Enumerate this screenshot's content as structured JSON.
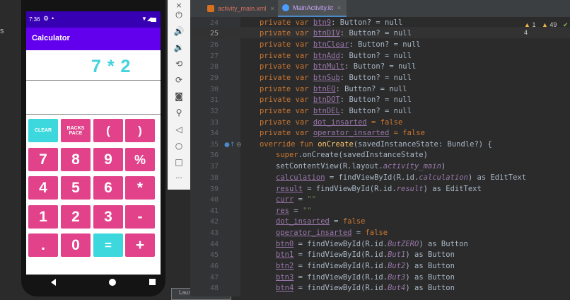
{
  "sidebar": {
    "fragment": "s"
  },
  "phone": {
    "status": {
      "time": "7:36",
      "gear": "⚙",
      "dot": "•",
      "wifi": "▼◢"
    },
    "app_title": "Calculator",
    "calculation": "7 * 2",
    "result": "",
    "buttons": {
      "clear": "CLEAR",
      "backspace": "BACKS PACE",
      "lparen": "(",
      "rparen": ")",
      "b7": "7",
      "b8": "8",
      "b9": "9",
      "percent": "%",
      "b4": "4",
      "b5": "5",
      "b6": "6",
      "mult": "*",
      "b1": "1",
      "b2": "2",
      "b3": "3",
      "minus": "-",
      "dot": ".",
      "b0": "0",
      "eq": "=",
      "plus": "+"
    },
    "nav": {
      "back": "back-icon",
      "home": "home-icon",
      "recents": "recents-icon"
    }
  },
  "toolbar": {
    "close": "×",
    "more": "···"
  },
  "toast": "Launch succeeded",
  "tabs": [
    {
      "label": "activity_main.xml",
      "close": "×"
    },
    {
      "label": "MainActivity.kt",
      "close": "×"
    }
  ],
  "inspections": {
    "warn_count": "1",
    "weak_count": "49",
    "typo_count": "4"
  },
  "editor": {
    "line_numbers": [
      "24",
      "25",
      "26",
      "27",
      "28",
      "29",
      "30",
      "31",
      "32",
      "33",
      "34",
      "35",
      "36",
      "37",
      "38",
      "39",
      "40",
      "41",
      "42",
      "43",
      "44",
      "45",
      "46",
      "47",
      "48"
    ],
    "lines": [
      {
        "a": "private var ",
        "b": "btn9",
        "c": ": Button? = null"
      },
      {
        "a": "private var ",
        "b": "btnDIV",
        "c": ": Button? = null"
      },
      {
        "a": "private var ",
        "b": "btnClear",
        "c": ": Button? = null"
      },
      {
        "a": "private var ",
        "b": "btnAdd",
        "c": ": Button? = null"
      },
      {
        "a": "private var ",
        "b": "btnMult",
        "c": ": Button? = null"
      },
      {
        "a": "private var ",
        "b": "btnSub",
        "c": ": Button? = null"
      },
      {
        "a": "private var ",
        "b": "btnEQ",
        "c": ": Button? = null"
      },
      {
        "a": "private var ",
        "b": "btnDOT",
        "c": ": Button? = null"
      },
      {
        "a": "private var ",
        "b": "btnDEL",
        "c": ": Button? = null"
      },
      {
        "a": "private var ",
        "b": "dot_insarted",
        "c": " = false"
      },
      {
        "a": "private var ",
        "b": "operator_insarted",
        "c": " = false"
      },
      {
        "a": "override fun ",
        "b": "onCreate",
        "c": "(savedInstanceState: Bundle?) {"
      },
      {
        "a": "super",
        "b": ".onCreate(savedInstanceState)",
        "c": ""
      },
      {
        "a": "setContentView(R.layout.",
        "b": "activity_main",
        "c": ")"
      },
      {
        "a": "calculation",
        "b": " = findViewById(R.id.",
        "c": "calculation",
        "d": ") as EditText"
      },
      {
        "a": "result",
        "b": " = findViewById(R.id.",
        "c": "result",
        "d": ") as EditText"
      },
      {
        "a": "curr",
        "b": " = ",
        "c": "\"\""
      },
      {
        "a": "res",
        "b": " = ",
        "c": "\"\""
      },
      {
        "a": "dot_insarted",
        "b": " = ",
        "c": "false"
      },
      {
        "a": "operator_insarted",
        "b": " = ",
        "c": "false"
      },
      {
        "a": "btn0",
        "b": " = findViewById(R.id.",
        "c": "ButZERO",
        "d": ") as Button"
      },
      {
        "a": "btn1",
        "b": " = findViewById(R.id.",
        "c": "But1",
        "d": ") as Button"
      },
      {
        "a": "btn2",
        "b": " = findViewById(R.id.",
        "c": "But2",
        "d": ") as Button"
      },
      {
        "a": "btn3",
        "b": " = findViewById(R.id.",
        "c": "But3",
        "d": ") as Button"
      },
      {
        "a": "btn4",
        "b": " = findViewById(R.id.",
        "c": "But4",
        "d": ") as Button"
      }
    ]
  }
}
